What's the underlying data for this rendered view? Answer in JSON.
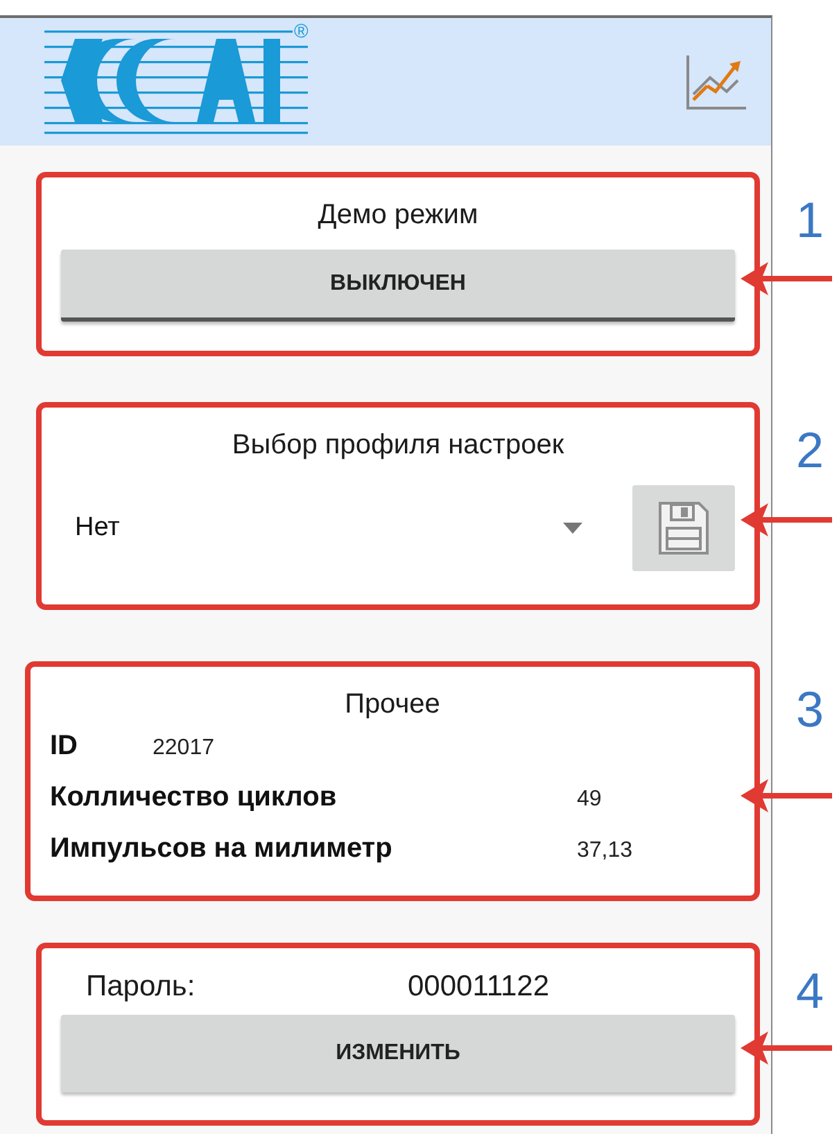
{
  "header": {
    "logo_mark": "®"
  },
  "sections": [
    {
      "kind": "toggle",
      "callout": "1",
      "title": "Демо режим",
      "button": {
        "label": "ВЫКЛЮЧЕН",
        "on": false
      }
    },
    {
      "kind": "profile",
      "callout": "2",
      "title": "Выбор профиля настроек",
      "select": {
        "value": "Нет"
      },
      "save": {
        "disabled": true
      }
    },
    {
      "kind": "info",
      "callout": "3",
      "title": "Прочее",
      "rows": [
        {
          "kind": "inline",
          "label": "ID",
          "value": "22017"
        },
        {
          "kind": "column",
          "label": "Колличество циклов",
          "value": "49"
        },
        {
          "kind": "column",
          "label": "Импульсов на милиметр",
          "value": "37,13"
        }
      ]
    },
    {
      "kind": "password",
      "callout": "4",
      "label": "Пароль:",
      "value": "000011122",
      "button": {
        "label": "ИЗМЕНИТЬ"
      }
    }
  ]
}
